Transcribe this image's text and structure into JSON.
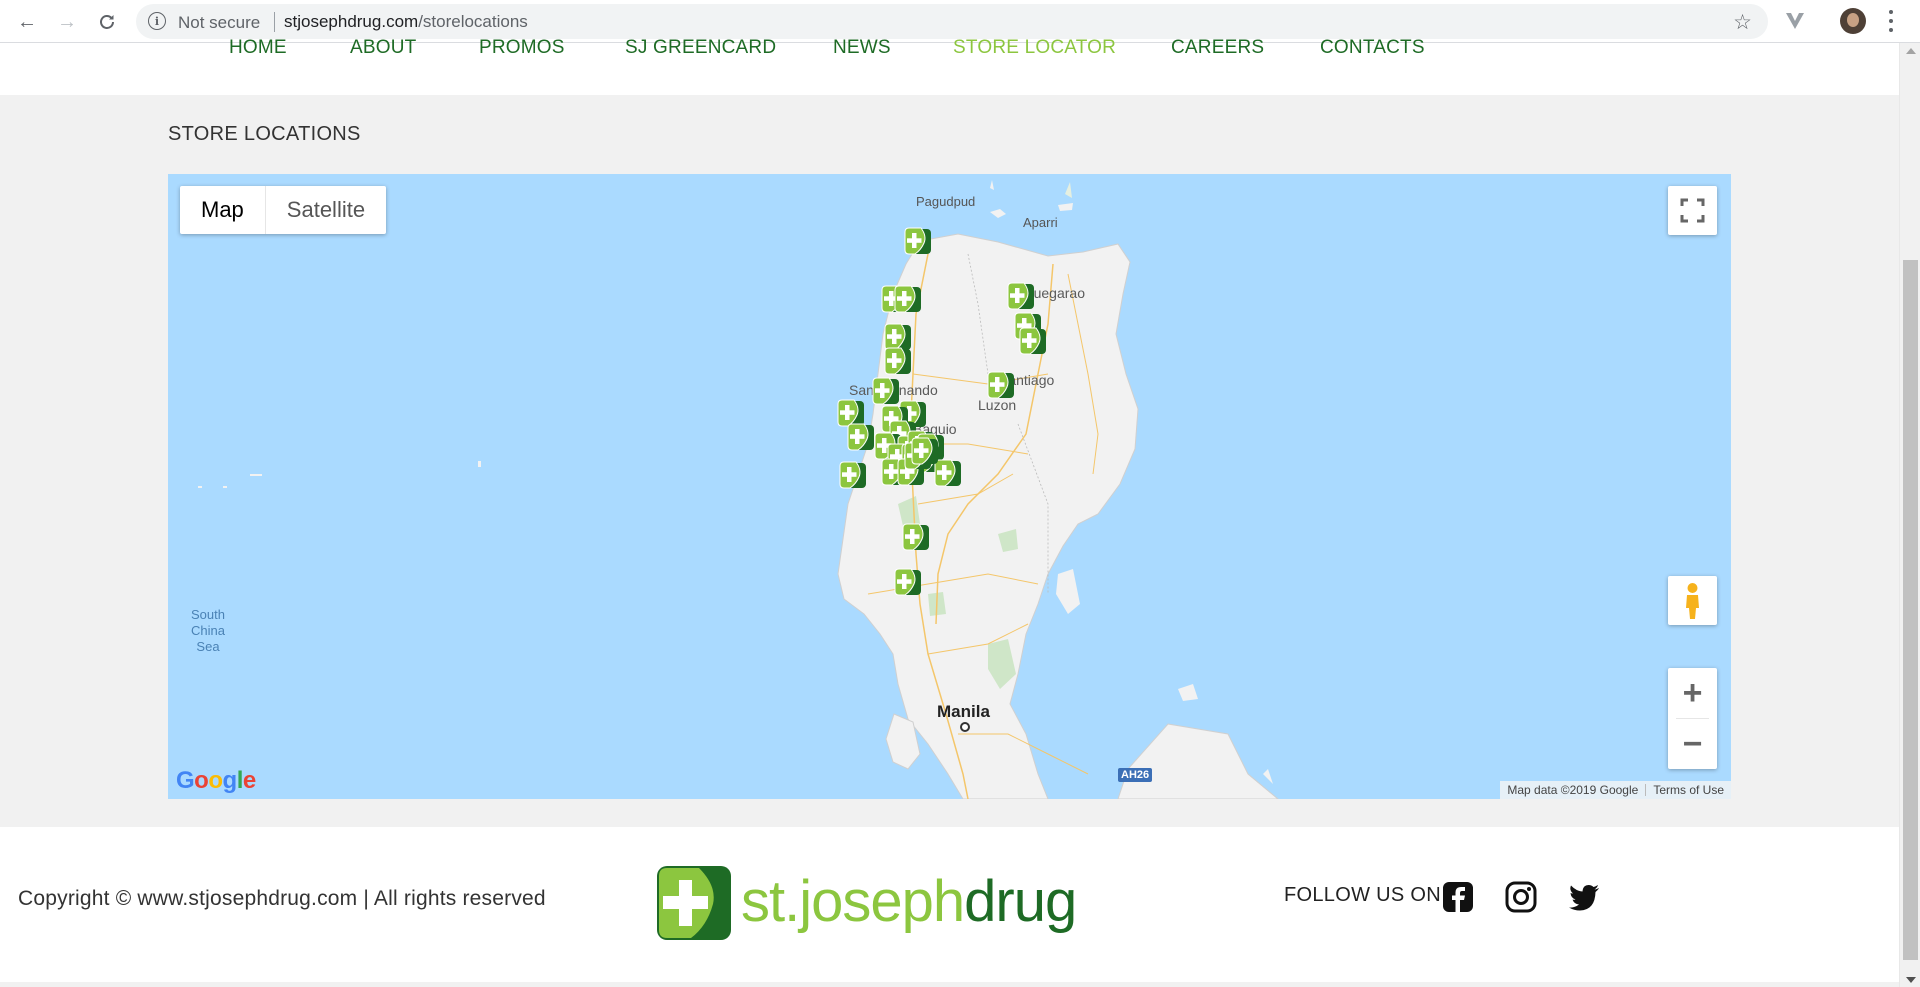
{
  "browser": {
    "security_label": "Not secure",
    "url_host": "stjosephdrug.com",
    "url_path": "/storelocations"
  },
  "nav": {
    "items": [
      {
        "label": "HOME"
      },
      {
        "label": "ABOUT"
      },
      {
        "label": "PROMOS"
      },
      {
        "label": "SJ GREENCARD"
      },
      {
        "label": "NEWS"
      },
      {
        "label": "STORE LOCATOR",
        "active": true
      },
      {
        "label": "CAREERS"
      },
      {
        "label": "CONTACTS"
      }
    ]
  },
  "page_title": "STORE LOCATIONS",
  "map": {
    "type_options": [
      "Map",
      "Satellite"
    ],
    "selected_type": "Map",
    "labels": {
      "pagudpud": "Pagudpud",
      "aparri": "Aparri",
      "tuguegarao": "Tuguegarao",
      "santiago": "Santiago",
      "san_fernando": "San Fernando",
      "luzon": "Luzon",
      "baguio": "Baguio",
      "manila": "Manila",
      "south_china_sea": "South China Sea",
      "highway": "AH26"
    },
    "attribution": "Map data ©2019 Google",
    "terms": "Terms of Use",
    "logo": "Google",
    "store_marker_icon": "pharmacy-cross-icon",
    "water_color": "#aadaff",
    "land_color": "#f2f2f2"
  },
  "footer": {
    "copyright": "Copyright © www.stjosephdrug.com | All rights reserved",
    "brand_part1": "st.joseph",
    "brand_part2": "drug",
    "follow_label": "FOLLOW US ON",
    "social": [
      "facebook-icon",
      "instagram-icon",
      "twitter-icon"
    ]
  },
  "colors": {
    "brand_light": "#8cc63f",
    "brand_dark": "#1e6b25"
  }
}
